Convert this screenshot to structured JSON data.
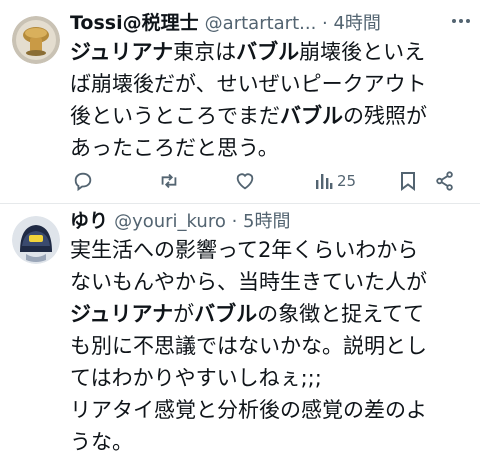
{
  "tweet1": {
    "name": "Tossi@税理士",
    "handle": "@artartart...",
    "sep": " · ",
    "time": "4時間",
    "lines": [
      {
        "b1": "ジュリアナ",
        "t1": "東京は",
        "b2": "バブル",
        "t2": "崩壊後といえ"
      },
      {
        "t1": "ば崩壊後だが、せいぜいピークアウト"
      },
      {
        "t1": "後というところでまだ",
        "b1": "バブル",
        "t2": "の残照が"
      },
      {
        "t1": "あったころだと思う。"
      }
    ],
    "actions": {
      "reply_icon": "reply-icon",
      "retweet_icon": "retweet-icon",
      "like_icon": "heart-icon",
      "views_icon": "views-icon",
      "views_count": "25",
      "bookmark_icon": "bookmark-icon",
      "share_icon": "share-icon"
    }
  },
  "tweet2": {
    "name": "ゆり",
    "handle": "@youri_kuro",
    "sep": " · ",
    "time": "5時間",
    "lines": [
      {
        "t1": "実生活への影響って2年くらいわから"
      },
      {
        "t1": "ないもんやから、当時生きていた人が"
      },
      {
        "b1": "ジュリアナ",
        "t1": "が",
        "b2": "バブル",
        "t2": "の象徴と捉えてて"
      },
      {
        "t1": "も別に不思議ではないかな。説明とし"
      },
      {
        "t1": "てはわかりやすいしねぇ;;;"
      },
      {
        "t1": "リアタイ感覚と分析後の感覚の差のよ"
      },
      {
        "t1": "うな。"
      }
    ]
  },
  "colors": {
    "text": "#0f1419",
    "secondary": "#536471",
    "divider": "#e6e9eb"
  }
}
